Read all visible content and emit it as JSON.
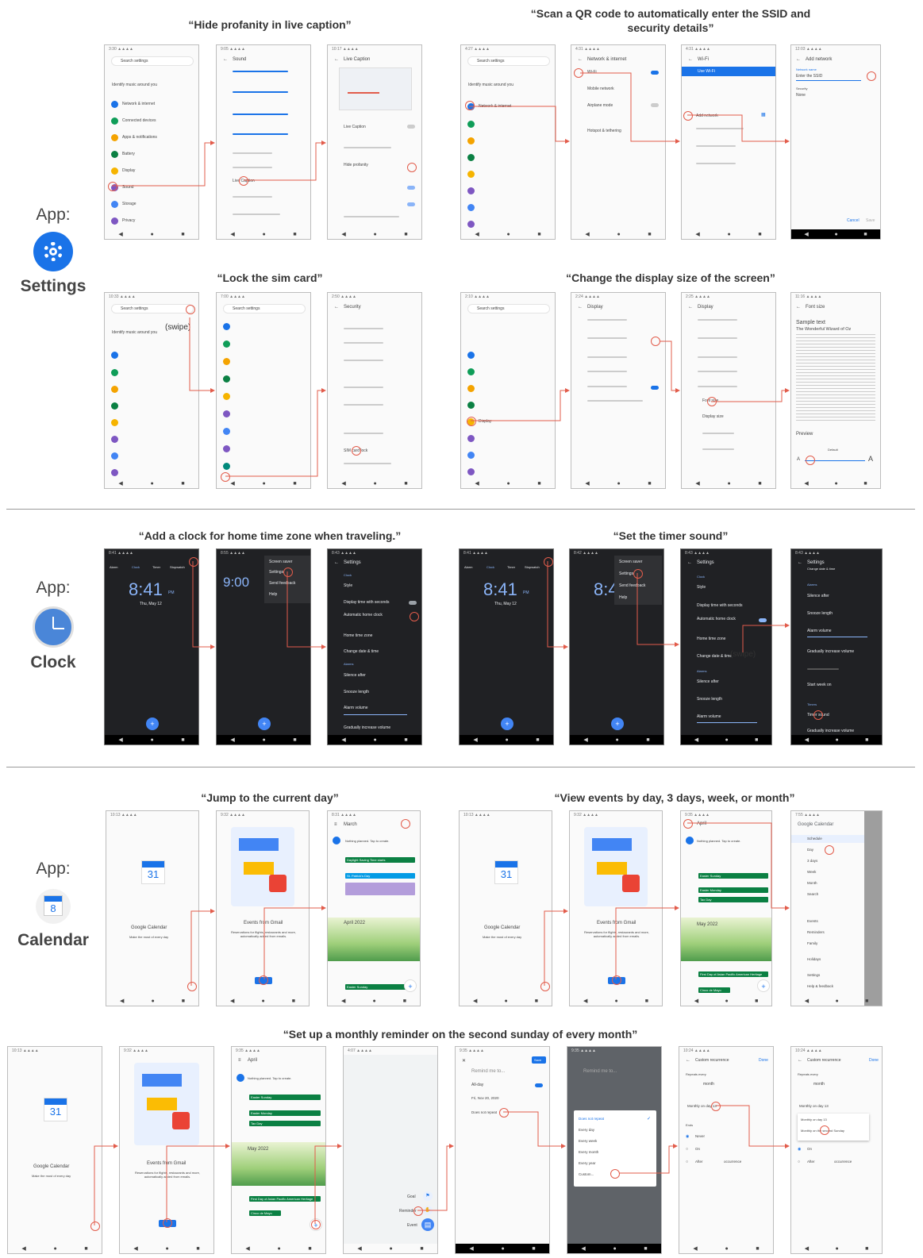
{
  "titles": {
    "t1": "“Hide profanity in live caption”",
    "t2": "“Scan a QR code to automatically enter the SSID and security details”",
    "t3": "“Lock the sim card”",
    "t4": "“Change the display size of the screen”",
    "t5": "“Add a clock for home time zone when traveling.”",
    "t6": "“Set the timer sound”",
    "t7": "“Jump to the current day”",
    "t8": "“View events by day, 3 days, week, or month”",
    "t9": "“Set up a monthly reminder on the second sunday of every month”"
  },
  "apps": {
    "prefix": "App:",
    "settings": "Settings",
    "clock": "Clock",
    "calendar": "Calendar",
    "calendar_icon_num": "8"
  },
  "swipe": "(swipe)",
  "settings_screens": {
    "search": "Search settings",
    "music": "Identify music around you",
    "items": [
      "Network & internet",
      "Connected devices",
      "Apps & notifications",
      "Battery",
      "Display",
      "Sound",
      "Storage",
      "Privacy"
    ],
    "sound_title": "Sound",
    "live_caption_title": "Live Caption",
    "live_caption": "Live Caption",
    "hide_profanity": "Hide profanity",
    "network_title": "Network & internet",
    "wifi": "Wi-Fi",
    "mobile": "Mobile network",
    "airplane": "Airplane mode",
    "hotspot": "Hotspot & tethering",
    "wifi_title": "Wi-Fi",
    "use_wifi": "Use Wi-Fi",
    "add_network": "Add network",
    "add_network_title": "Add network",
    "network_name": "Network name",
    "enter_ssid": "Enter the SSID",
    "security": "Security",
    "security_none": "None",
    "security_title": "Security",
    "sim_lock": "SIM card lock",
    "display_title": "Display",
    "font_size_title": "Font size",
    "font_size_item": "Font size",
    "display_size_item": "Display size",
    "sample_text": "Sample text",
    "oz": "The Wonderful Wizard of Oz",
    "preview": "Preview",
    "default": "Default",
    "cancel": "Cancel",
    "save": "Save"
  },
  "clock_screens": {
    "tabs": [
      "Alarm",
      "Clock",
      "Timer",
      "Stopwatch"
    ],
    "time": "8:41",
    "ampm": "PM",
    "date": "Thu, May 12",
    "time2": "9:00",
    "menu": [
      "Screen saver",
      "Settings",
      "Send feedback",
      "Help"
    ],
    "settings_title": "Settings",
    "clock_sec": "Clock",
    "style": "Style",
    "display_seconds": "Display time with seconds",
    "auto_home": "Automatic home clock",
    "home_tz": "Home time zone",
    "change_dt": "Change date & time",
    "alarms": "Alarms",
    "silence": "Silence after",
    "snooze": "Snooze length",
    "alarm_volume": "Alarm volume",
    "gradual": "Gradually increase volume",
    "timer_sound": "Timer sound",
    "start_week": "Start week on",
    "timers": "Timers",
    "change_dt_sub": "Change date & time"
  },
  "calendar_screens": {
    "icon_num": "31",
    "app_title": "Google Calendar",
    "app_sub": "Make the most of every day",
    "gmail_title": "Events from Gmail",
    "gmail_sub": "Reservations for flights, restaurants and more, automatically added from emails.",
    "month_march": "March",
    "month_april": "April",
    "april2022": "April 2022",
    "may2022": "May 2022",
    "nothing": "Nothing planned. Tap to create.",
    "events": [
      "Daylight Saving Time starts",
      "St. Patrick's Day",
      "Easter Sunday",
      "Easter Monday",
      "Tax Day",
      "First Day of Asian Pacific American Heritage",
      "Cinco de Mayo"
    ],
    "drawer_title": "Google Calendar",
    "drawer": [
      "Schedule",
      "Day",
      "3 days",
      "Week",
      "Month",
      "Search"
    ],
    "drawer2": [
      "Events",
      "Reminders",
      "Family",
      "Holidays",
      "Settings",
      "Help & feedback"
    ],
    "remind_me": "Remind me to...",
    "all_day": "All-day",
    "date_val": "Fri, Nov 20, 2020",
    "not_repeat": "Does not repeat",
    "save": "Save",
    "repeat_opts": [
      "Does not repeat",
      "Every day",
      "Every week",
      "Every month",
      "Every year",
      "Custom..."
    ],
    "custom_title": "Custom recurrence",
    "done": "Done",
    "repeats_every": "Repeats every",
    "month_unit": "month",
    "monthly_day": "Monthly on day 13",
    "monthly_sunday": "Monthly on the second Sunday",
    "ends": "Ends",
    "never": "Never",
    "on_date": "On",
    "after": "After",
    "occurrence": "occurrence",
    "goal": "Goal",
    "reminder": "Reminder",
    "event": "Event"
  }
}
